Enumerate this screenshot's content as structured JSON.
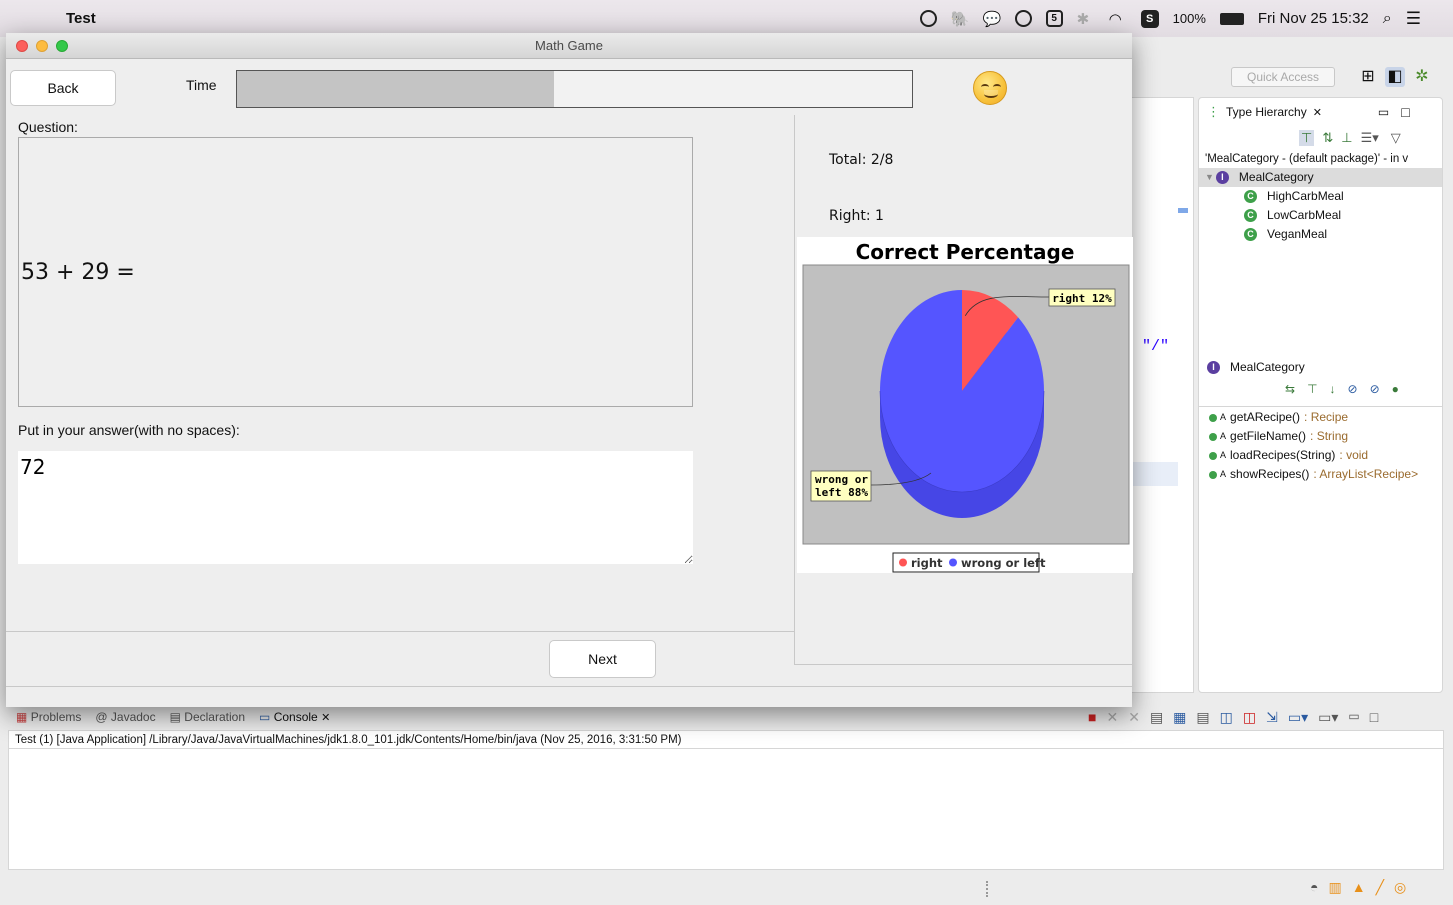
{
  "menubar": {
    "apple_glyph": "",
    "app_name": "Test",
    "battery": "100%",
    "datetime": "Fri Nov 25  15:32",
    "icons": [
      "screen-capture-icon",
      "evernote-icon",
      "wechat-icon",
      "circle-icon",
      "square-5-icon",
      "bluetooth-icon",
      "wifi-icon",
      "s-app-icon",
      "battery-icon",
      "search-icon",
      "menu-list-icon"
    ]
  },
  "eclipse": {
    "quick_access": "Quick Access",
    "editor_string": "\"/\"",
    "type_hierarchy": {
      "tab_label": "Type Hierarchy",
      "tab_close": "✕",
      "scope": "'MealCategory - (default package)' - in v",
      "root": "MealCategory",
      "children": [
        "HighCarbMeal",
        "LowCarbMeal",
        "VeganMeal"
      ],
      "member_header": "MealCategory",
      "methods": [
        {
          "name": "getARecipe()",
          "type": ": Recipe"
        },
        {
          "name": "getFileName()",
          "type": ": String"
        },
        {
          "name": "loadRecipes(String)",
          "type": ": void"
        },
        {
          "name": "showRecipes()",
          "type": ": ArrayList<Recipe>"
        }
      ]
    },
    "console_tabs": {
      "problems": "Problems",
      "javadoc": "Javadoc",
      "declaration": "Declaration",
      "console": "Console",
      "console_close": "✕"
    },
    "console_line": "Test (1) [Java Application] /Library/Java/JavaVirtualMachines/jdk1.8.0_101.jdk/Contents/Home/bin/java (Nov 25, 2016, 3:31:50 PM)"
  },
  "math_game": {
    "window_title": "Math Game",
    "back_label": "Back",
    "time_label": "Time",
    "time_progress": 0.47,
    "question_label": "Question:",
    "question_text": "53 + 29 =",
    "answer_label": "Put in your answer(with no spaces):",
    "answer_value": "72",
    "next_label": "Next",
    "total_label": "Total: 2/8",
    "right_label": "Right: 1"
  },
  "chart_data": {
    "type": "pie",
    "title": "Correct Percentage",
    "slices": [
      {
        "name": "right",
        "value": 12,
        "label": "right  12%",
        "color": "#ff5555"
      },
      {
        "name": "wrong or left",
        "value": 88,
        "label_line1": "wrong or",
        "label_line2": "left  88%",
        "color": "#5555ff"
      }
    ],
    "legend": [
      {
        "name": "right",
        "color": "#ff5555"
      },
      {
        "name": "wrong or left",
        "color": "#5555ff"
      }
    ],
    "legend_position": "bottom",
    "plot_background": "#c0c0c0"
  }
}
